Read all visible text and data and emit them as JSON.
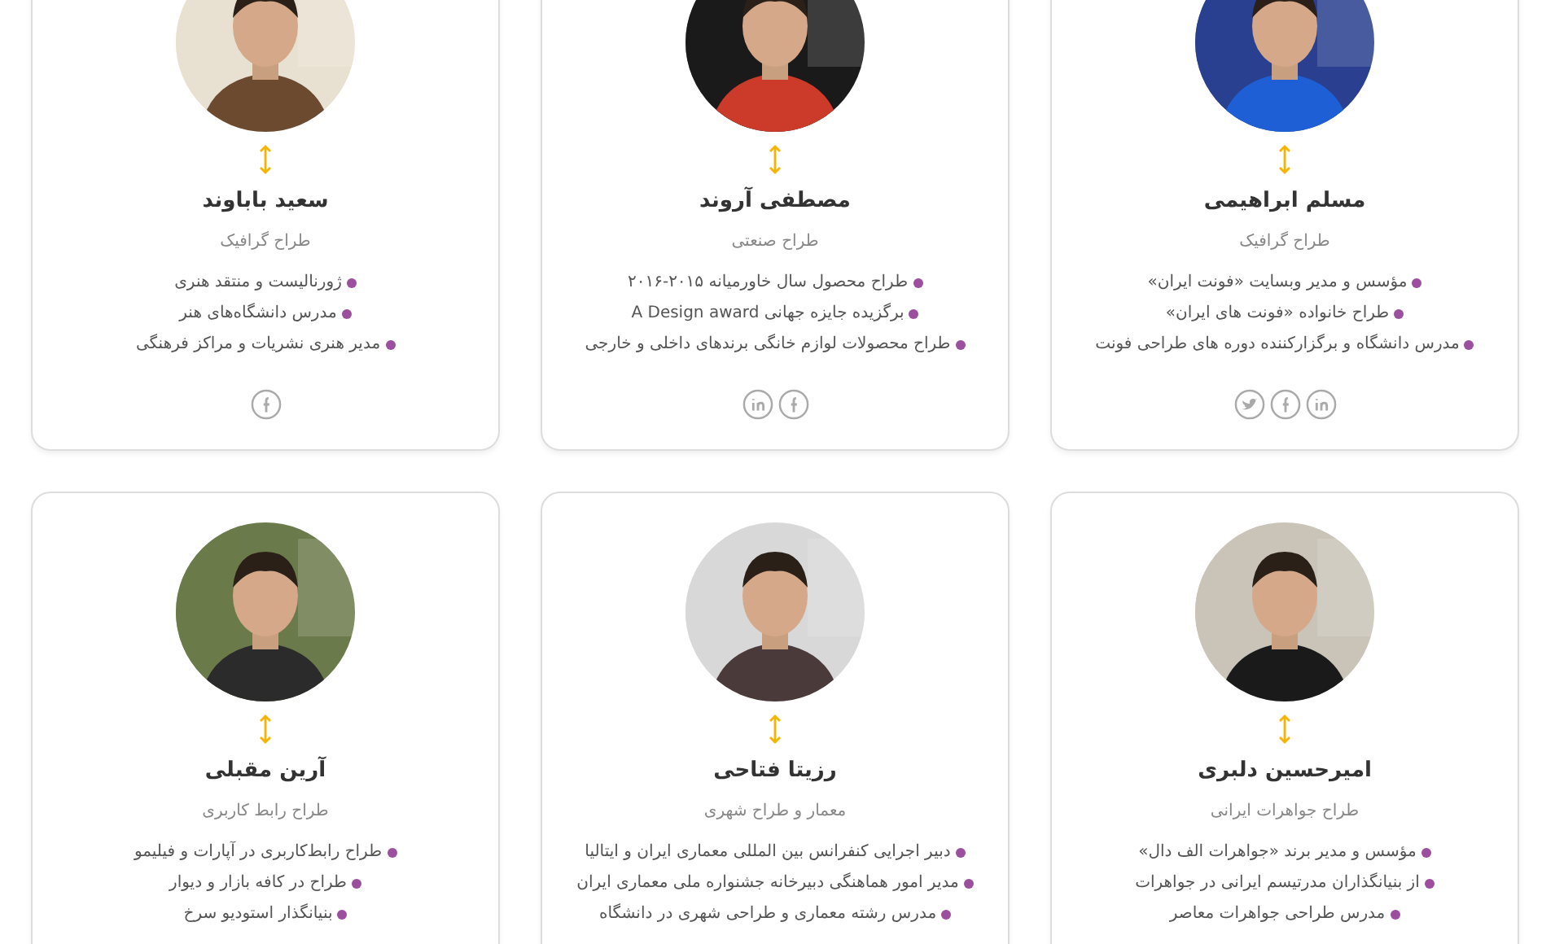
{
  "team": [
    {
      "name": "مسلم ابراهیمی",
      "role": "طراح گرافیک",
      "items": [
        "مؤسس و مدیر وبسایت «فونت ایران»",
        "طراح خانواده «فونت های ایران»",
        "مدرس دانشگاه و برگزارکننده دوره های طراحی فونت"
      ],
      "social": [
        {
          "kind": "linkedin"
        },
        {
          "kind": "facebook"
        },
        {
          "kind": "twitter"
        }
      ]
    },
    {
      "name": "مصطفی آروند",
      "role": "طراح صنعتی",
      "items": [
        "طراح محصول سال خاورمیانه ۲۰۱۵-۲۰۱۶",
        "برگزیده جایزه جهانی A Design award",
        "طراح محصولات لوازم خانگی برندهای داخلی و خارجی"
      ],
      "social": [
        {
          "kind": "facebook"
        },
        {
          "kind": "linkedin"
        }
      ]
    },
    {
      "name": "سعید باباوند",
      "role": "طراح گرافیک",
      "items": [
        "ژورنالیست و منتقد هنری",
        "مدرس دانشگاه‌های هنر",
        "مدیر هنری نشریات و مراکز فرهنگی"
      ],
      "social": [
        {
          "kind": "facebook"
        }
      ]
    },
    {
      "name": "امیرحسین دلبری",
      "role": "طراح جواهرات ایرانی",
      "items": [
        "مؤسس و مدیر برند «جواهرات الف دال»",
        "از بنیانگذاران مدرتیسم ایرانی در جواهرات",
        "مدرس طراحی جواهرات معاصر"
      ]
    },
    {
      "name": "رزیتا فتاحی",
      "role": "معمار و طراح شهری",
      "items": [
        "دبیر اجرایی کنفرانس بین المللی معماری ایران و ایتالیا",
        "مدیر امور هماهنگی دبیرخانه جشنواره ملی معماری ایران",
        "مدرس رشته معماری و طراحی شهری در دانشگاه"
      ]
    },
    {
      "name": "آرین مقبلی",
      "role": "طراح رابط کاربری",
      "items": [
        "طراح رابط‌کاربری در آپارات و فیلیمو",
        "طراح در کافه بازار و دیوار",
        "بنیانگذار استودیو سرخ"
      ]
    }
  ]
}
